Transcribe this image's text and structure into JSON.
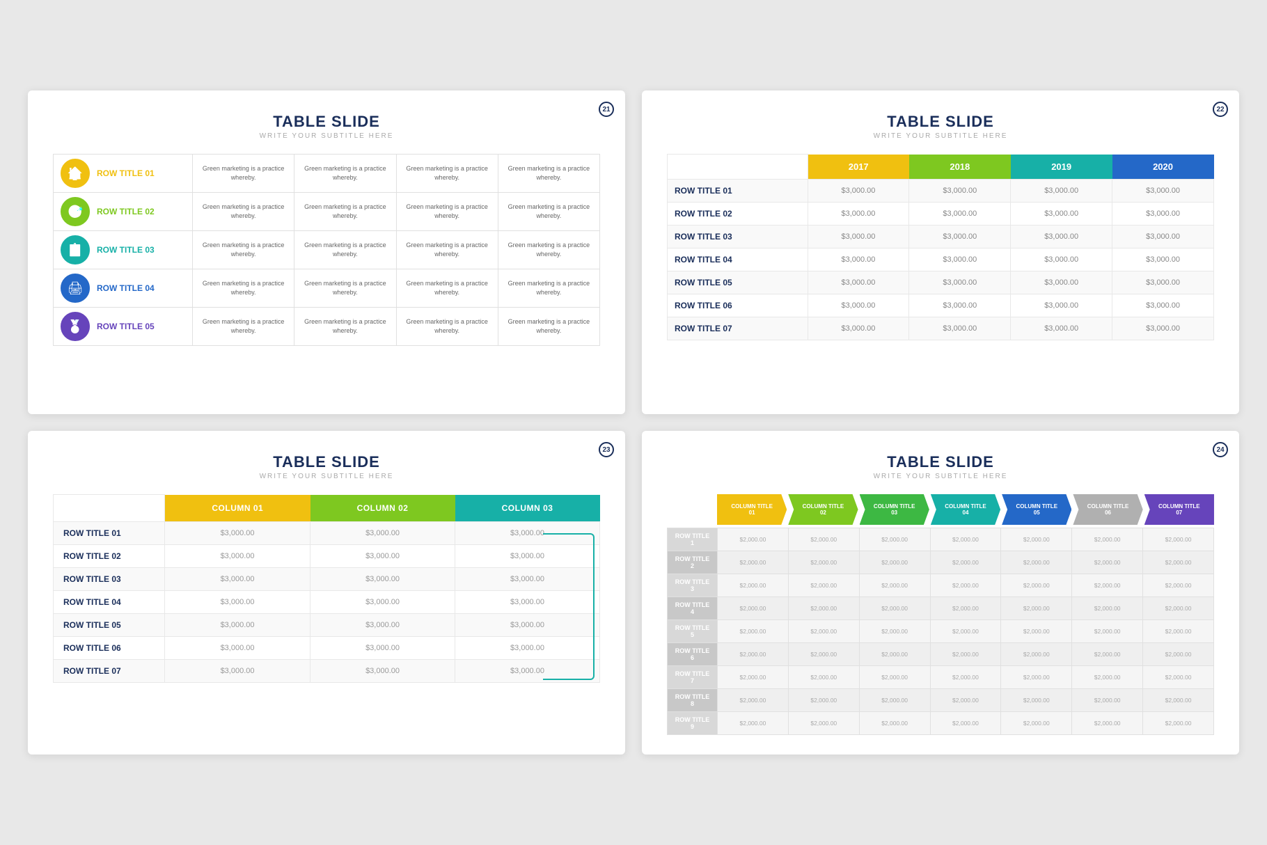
{
  "slides": [
    {
      "id": "slide1",
      "number": "21",
      "title": "TABLE SLIDE",
      "subtitle": "WRITE YOUR SUBTITLE HERE",
      "rows": [
        {
          "icon": "🏠",
          "iconBg": "#f0c010",
          "iconBorder": "#f0c010",
          "titleColor": "#f0c010",
          "title": "ROW TITLE 01",
          "cells": [
            "Green marketing is a practice whereby.",
            "Green marketing is a practice whereby.",
            "Green marketing is a practice whereby.",
            "Green marketing is a practice whereby."
          ]
        },
        {
          "icon": "🎯",
          "iconBg": "#7ec820",
          "iconBorder": "#7ec820",
          "titleColor": "#7ec820",
          "title": "ROW TITLE 02",
          "cells": [
            "Green marketing is a practice whereby.",
            "Green marketing is a practice whereby.",
            "Green marketing is a practice whereby.",
            "Green marketing is a practice whereby."
          ]
        },
        {
          "icon": "📋",
          "iconBg": "#17b0a7",
          "iconBorder": "#17b0a7",
          "titleColor": "#17b0a7",
          "title": "ROW TITLE 03",
          "cells": [
            "Green marketing is a practice whereby.",
            "Green marketing is a practice whereby.",
            "Green marketing is a practice whereby.",
            "Green marketing is a practice whereby."
          ]
        },
        {
          "icon": "🖨",
          "iconBg": "#2468c8",
          "iconBorder": "#2468c8",
          "titleColor": "#2468c8",
          "title": "ROW TITLE 04",
          "cells": [
            "Green marketing is a practice whereby.",
            "Green marketing is a practice whereby.",
            "Green marketing is a practice whereby.",
            "Green marketing is a practice whereby."
          ]
        },
        {
          "icon": "🏅",
          "iconBg": "#6644bb",
          "iconBorder": "#6644bb",
          "titleColor": "#6644bb",
          "title": "ROW TITLE 05",
          "cells": [
            "Green marketing is a practice whereby.",
            "Green marketing is a practice whereby.",
            "Green marketing is a practice whereby.",
            "Green marketing is a practice whereby."
          ]
        }
      ]
    },
    {
      "id": "slide2",
      "number": "22",
      "title": "TABLE SLIDE",
      "subtitle": "WRITE YOUR SUBTITLE HERE",
      "years": [
        "2017",
        "2018",
        "2019",
        "2020"
      ],
      "yearColors": [
        "#f0c010",
        "#7ec820",
        "#17b0a7",
        "#2468c8"
      ],
      "rows": [
        {
          "title": "ROW TITLE 01",
          "values": [
            "$3,000.00",
            "$3,000.00",
            "$3,000.00",
            "$3,000.00"
          ]
        },
        {
          "title": "ROW TITLE 02",
          "values": [
            "$3,000.00",
            "$3,000.00",
            "$3,000.00",
            "$3,000.00"
          ]
        },
        {
          "title": "ROW TITLE 03",
          "values": [
            "$3,000.00",
            "$3,000.00",
            "$3,000.00",
            "$3,000.00"
          ]
        },
        {
          "title": "ROW TITLE 04",
          "values": [
            "$3,000.00",
            "$3,000.00",
            "$3,000.00",
            "$3,000.00"
          ]
        },
        {
          "title": "ROW TITLE 05",
          "values": [
            "$3,000.00",
            "$3,000.00",
            "$3,000.00",
            "$3,000.00"
          ]
        },
        {
          "title": "ROW TITLE 06",
          "values": [
            "$3,000.00",
            "$3,000.00",
            "$3,000.00",
            "$3,000.00"
          ]
        },
        {
          "title": "ROW TITLE 07",
          "values": [
            "$3,000.00",
            "$3,000.00",
            "$3,000.00",
            "$3,000.00"
          ]
        }
      ]
    },
    {
      "id": "slide3",
      "number": "23",
      "title": "TABLE SLIDE",
      "subtitle": "WRITE YOUR SUBTITLE HERE",
      "columns": [
        "COLUMN 01",
        "COLUMN 02",
        "COLUMN 03"
      ],
      "columnColors": [
        "#f0c010",
        "#7ec820",
        "#17b0a7"
      ],
      "rows": [
        {
          "title": "ROW TITLE 01",
          "values": [
            "$3,000.00",
            "$3,000.00",
            "$3,000.00"
          ]
        },
        {
          "title": "ROW TITLE 02",
          "values": [
            "$3,000.00",
            "$3,000.00",
            "$3,000.00"
          ]
        },
        {
          "title": "ROW TITLE 03",
          "values": [
            "$3,000.00",
            "$3,000.00",
            "$3,000.00"
          ]
        },
        {
          "title": "ROW TITLE 04",
          "values": [
            "$3,000.00",
            "$3,000.00",
            "$3,000.00"
          ]
        },
        {
          "title": "ROW TITLE 05",
          "values": [
            "$3,000.00",
            "$3,000.00",
            "$3,000.00"
          ]
        },
        {
          "title": "ROW TITLE 06",
          "values": [
            "$3,000.00",
            "$3,000.00",
            "$3,000.00"
          ]
        },
        {
          "title": "ROW TITLE 07",
          "values": [
            "$3,000.00",
            "$3,000.00",
            "$3,000.00"
          ]
        }
      ]
    },
    {
      "id": "slide4",
      "number": "24",
      "title": "TABLE SLIDE",
      "subtitle": "WRITE YOUR SUBTITLE HERE",
      "columns": [
        "COLUMN TITLE 01",
        "COLUMN TITLE 02",
        "COLUMN TITLE 03",
        "COLUMN TITLE 04",
        "COLUMN TITLE 05",
        "COLUMN TITLE 06",
        "COLUMN TITLE 07"
      ],
      "columnColors": [
        "#f0c010",
        "#7ec820",
        "#3db843",
        "#17b0a7",
        "#2468c8",
        "#b0b0b0",
        "#6644bb"
      ],
      "rows": [
        {
          "title": "ROW TITLE 1",
          "values": [
            "$2,000.00",
            "$2,000.00",
            "$2,000.00",
            "$2,000.00",
            "$2,000.00",
            "$2,000.00",
            "$2,000.00"
          ]
        },
        {
          "title": "ROW TITLE 2",
          "values": [
            "$2,000.00",
            "$2,000.00",
            "$2,000.00",
            "$2,000.00",
            "$2,000.00",
            "$2,000.00",
            "$2,000.00"
          ]
        },
        {
          "title": "ROW TITLE 3",
          "values": [
            "$2,000.00",
            "$2,000.00",
            "$2,000.00",
            "$2,000.00",
            "$2,000.00",
            "$2,000.00",
            "$2,000.00"
          ]
        },
        {
          "title": "ROW TITLE 4",
          "values": [
            "$2,000.00",
            "$2,000.00",
            "$2,000.00",
            "$2,000.00",
            "$2,000.00",
            "$2,000.00",
            "$2,000.00"
          ]
        },
        {
          "title": "ROW TITLE 5",
          "values": [
            "$2,000.00",
            "$2,000.00",
            "$2,000.00",
            "$2,000.00",
            "$2,000.00",
            "$2,000.00",
            "$2,000.00"
          ]
        },
        {
          "title": "ROW TITLE 6",
          "values": [
            "$2,000.00",
            "$2,000.00",
            "$2,000.00",
            "$2,000.00",
            "$2,000.00",
            "$2,000.00",
            "$2,000.00"
          ]
        },
        {
          "title": "ROW TITLE 7",
          "values": [
            "$2,000.00",
            "$2,000.00",
            "$2,000.00",
            "$2,000.00",
            "$2,000.00",
            "$2,000.00",
            "$2,000.00"
          ]
        },
        {
          "title": "ROW TITLE 8",
          "values": [
            "$2,000.00",
            "$2,000.00",
            "$2,000.00",
            "$2,000.00",
            "$2,000.00",
            "$2,000.00",
            "$2,000.00"
          ]
        },
        {
          "title": "ROW TITLE 9",
          "values": [
            "$2,000.00",
            "$2,000.00",
            "$2,000.00",
            "$2,000.00",
            "$2,000.00",
            "$2,000.00",
            "$2,000.00"
          ]
        }
      ]
    }
  ]
}
